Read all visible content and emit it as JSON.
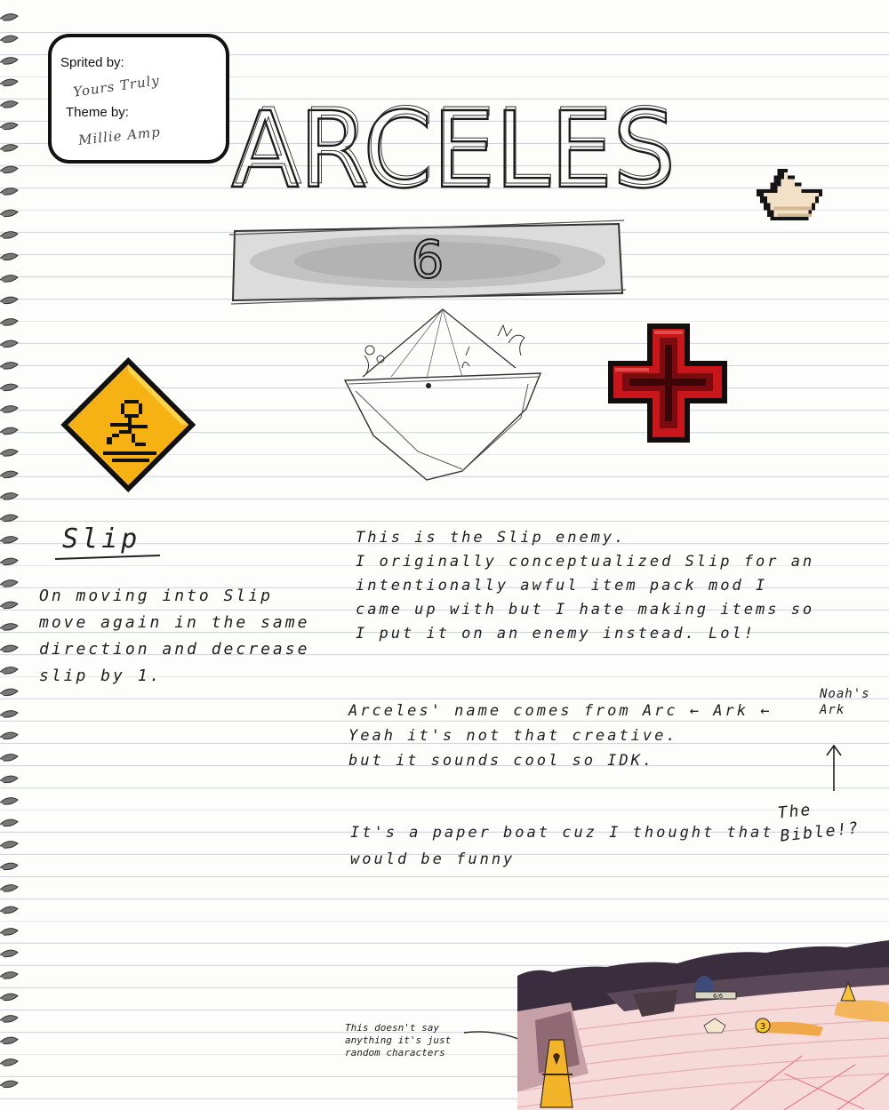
{
  "credits": {
    "sprited_label": "Sprited by:",
    "sprited_value": "Yours Truly",
    "theme_label": "Theme by:",
    "theme_value": "Millie Amp"
  },
  "title": "ARCELES",
  "banner_number": "6",
  "icons": {
    "boat": "paper-boat-icon",
    "cross": "red-cross-icon",
    "warning": "slip-warning-sign-icon"
  },
  "slip": {
    "heading": "Slip",
    "lines": [
      "On moving into Slip",
      "move again in the same",
      "direction and decrease",
      "slip by 1."
    ]
  },
  "notes": {
    "para1": [
      "This is the Slip enemy.",
      "I originally conceptualized Slip for an",
      "intentionally awful item pack mod I",
      "came up with but I hate making items so",
      "I put it on an enemy instead. Lol!"
    ],
    "para2": [
      "Arceles' name comes from Arc ← Ark ←",
      "Yeah it's not that creative.",
      "but it sounds cool so IDK."
    ],
    "noahs_ark": [
      "Noah's",
      "Ark"
    ],
    "bible": [
      "The",
      "Bible!?"
    ],
    "para3": [
      "It's a paper boat cuz I thought that",
      "would be funny"
    ]
  },
  "scene": {
    "caption": [
      "This doesn't say",
      "anything it's just",
      "random characters"
    ],
    "counter": "6/6",
    "badge": "3"
  }
}
